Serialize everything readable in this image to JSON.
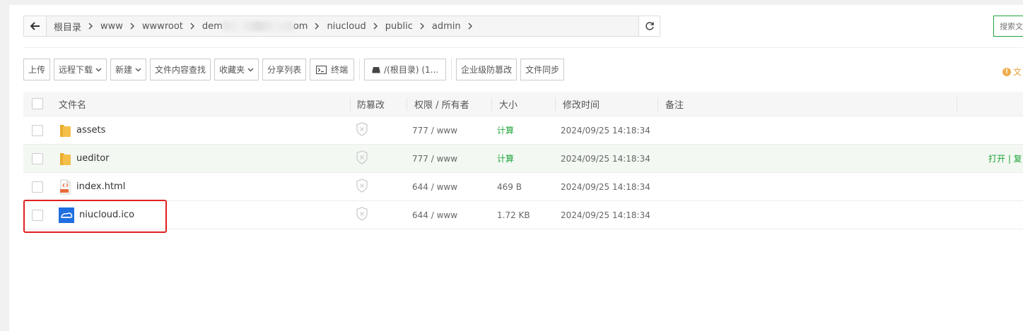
{
  "colors": {
    "accent": "#20a53a",
    "highlight": "#e02020",
    "folder": "#f5c04a"
  },
  "breadcrumb": {
    "back_icon": "arrow-left-icon",
    "items": [
      "根目录",
      "www",
      "wwwroot",
      "dem",
      "om",
      "niucloud",
      "public",
      "admin"
    ],
    "refresh_icon": "refresh-icon"
  },
  "search": {
    "placeholder": "搜索文"
  },
  "toolbar": {
    "upload": "上传",
    "remote_download": "远程下载",
    "new": "新建",
    "content_search": "文件内容查找",
    "favorites": "收藏夹",
    "share_list": "分享列表",
    "terminal": "终端",
    "disk": "/(根目录) (1...",
    "enterprise_protect": "企业级防篡改",
    "file_sync": "文件同步",
    "tip": "文"
  },
  "table": {
    "headers": {
      "name": "文件名",
      "protect": "防篡改",
      "perm": "权限 / 所有者",
      "size": "大小",
      "mtime": "修改时间",
      "note": "备注"
    },
    "rows": [
      {
        "name": "assets",
        "type": "folder",
        "perm": "777 / www",
        "size": "计算",
        "mtime": "2024/09/25 14:18:34"
      },
      {
        "name": "ueditor",
        "type": "folder",
        "perm": "777 / www",
        "size": "计算",
        "mtime": "2024/09/25 14:18:34",
        "ops": "打开 | 复"
      },
      {
        "name": "index.html",
        "type": "html",
        "perm": "644 / www",
        "size": "469 B",
        "mtime": "2024/09/25 14:18:34"
      },
      {
        "name": "niucloud.ico",
        "type": "ico",
        "perm": "644 / www",
        "size": "1.72 KB",
        "mtime": "2024/09/25 14:18:34"
      }
    ]
  }
}
